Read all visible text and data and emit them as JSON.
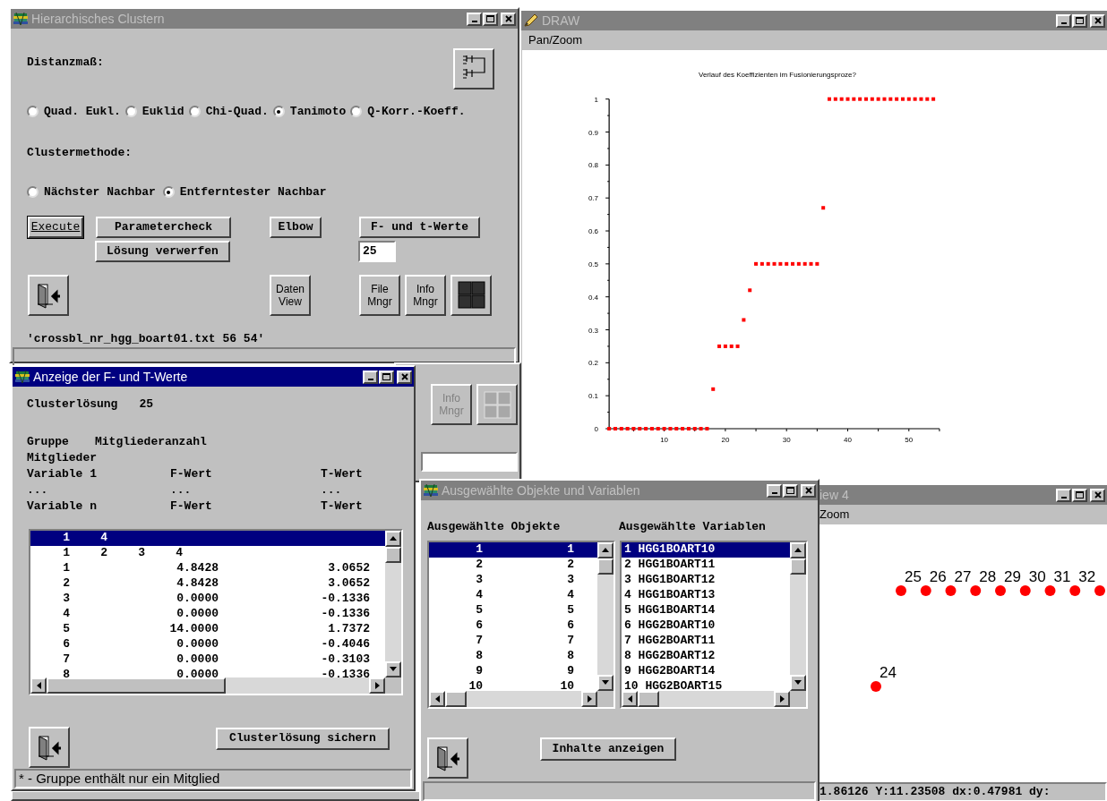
{
  "cluster_window": {
    "title": "Hierarchisches Clustern",
    "active": false,
    "distance_label": "Distanzmaß:",
    "distance_options": [
      {
        "label": "Quad. Eukl.",
        "selected": false
      },
      {
        "label": "Euklid",
        "selected": false
      },
      {
        "label": "Chi-Quad.",
        "selected": false
      },
      {
        "label": "Tanimoto",
        "selected": true
      },
      {
        "label": "Q-Korr.-Koeff.",
        "selected": false
      }
    ],
    "method_label": "Clustermethode:",
    "method_options": [
      {
        "label": "Nächster Nachbar",
        "selected": false
      },
      {
        "label": "Entferntester Nachbar",
        "selected": true
      }
    ],
    "action_buttons": [
      {
        "label": "Execute",
        "default": true
      },
      {
        "label": "Parametercheck",
        "default": false
      },
      {
        "label": "Elbow",
        "default": false
      },
      {
        "label": "F- und t-Werte",
        "default": false
      },
      {
        "label": "Lösung verwerfen",
        "default": false
      }
    ],
    "solution_field": {
      "value": "25"
    },
    "tool_buttons": [
      {
        "lines": [
          "Daten",
          "View"
        ]
      },
      {
        "lines": [
          "File",
          "Mngr"
        ]
      },
      {
        "lines": [
          "Info",
          "Mngr"
        ]
      }
    ],
    "file_info": "'crossbl_nr_hgg_boart01.txt 56 54'"
  },
  "behind_window": {
    "tool_buttons": [
      {
        "lines": [
          "Info",
          "Mngr"
        ],
        "disabled": true
      }
    ]
  },
  "draw_window": {
    "title": "DRAW",
    "active": false,
    "menu": [
      "Pan/Zoom"
    ],
    "chart_data": {
      "type": "scatter",
      "title": "Verlauf des Koeffizienten im Fusionierungsproze?",
      "x": [
        1,
        2,
        3,
        4,
        5,
        6,
        7,
        8,
        9,
        10,
        11,
        12,
        13,
        14,
        15,
        16,
        17,
        18,
        19,
        20,
        21,
        22,
        23,
        24,
        25,
        26,
        27,
        28,
        29,
        30,
        31,
        32,
        33,
        34,
        35,
        36,
        37,
        38,
        39,
        40,
        41,
        42,
        43,
        44,
        45,
        46,
        47,
        48,
        49,
        50,
        51,
        52,
        53,
        54
      ],
      "series": [
        {
          "color": "#ff0000",
          "values": [
            0,
            0,
            0,
            0,
            0,
            0,
            0,
            0,
            0,
            0,
            0,
            0,
            0,
            0,
            0,
            0,
            0,
            0.12,
            0.25,
            0.25,
            0.25,
            0.25,
            0.33,
            0.42,
            0.5,
            0.5,
            0.5,
            0.5,
            0.5,
            0.5,
            0.5,
            0.5,
            0.5,
            0.5,
            0.5,
            0.67,
            1,
            1,
            1,
            1,
            1,
            1,
            1,
            1,
            1,
            1,
            1,
            1,
            1,
            1,
            1,
            1,
            1,
            1
          ]
        }
      ],
      "xlim": [
        1,
        55
      ],
      "ylim": [
        0,
        1
      ],
      "xticks": [
        10,
        20,
        30,
        40,
        50
      ],
      "yticks": [
        0,
        0.1,
        0.2,
        0.3,
        0.4,
        0.5,
        0.6,
        0.7,
        0.8,
        0.9,
        1
      ]
    }
  },
  "view_window": {
    "title": "iew 4",
    "active": false,
    "menu": [
      "Zoom"
    ],
    "points": [
      {
        "label": "24",
        "kind": "low"
      },
      {
        "label": "25",
        "kind": "high"
      },
      {
        "label": "26",
        "kind": "high"
      },
      {
        "label": "27",
        "kind": "high"
      },
      {
        "label": "28",
        "kind": "high"
      },
      {
        "label": "29",
        "kind": "high"
      },
      {
        "label": "30",
        "kind": "high"
      },
      {
        "label": "31",
        "kind": "high"
      },
      {
        "label": "32",
        "kind": "high"
      },
      {
        "kind": "high"
      }
    ],
    "status": "1.86126 Y:11.23508 dx:0.47981 dy:"
  },
  "selection_window": {
    "title": "Ausgewählte Objekte und Variablen",
    "active": false,
    "objects_label": "Ausgewählte Objekte",
    "variables_label": "Ausgewählte Variablen",
    "objects": [
      {
        "cells": [
          "1",
          "1"
        ],
        "selected": true
      },
      {
        "cells": [
          "2",
          "2"
        ],
        "selected": false
      },
      {
        "cells": [
          "3",
          "3"
        ],
        "selected": false
      },
      {
        "cells": [
          "4",
          "4"
        ],
        "selected": false
      },
      {
        "cells": [
          "5",
          "5"
        ],
        "selected": false
      },
      {
        "cells": [
          "6",
          "6"
        ],
        "selected": false
      },
      {
        "cells": [
          "7",
          "7"
        ],
        "selected": false
      },
      {
        "cells": [
          "8",
          "8"
        ],
        "selected": false
      },
      {
        "cells": [
          "9",
          "9"
        ],
        "selected": false
      },
      {
        "cells": [
          "10",
          "10"
        ],
        "selected": false
      }
    ],
    "variables": [
      {
        "text": "1 HGG1BOART10",
        "selected": true
      },
      {
        "text": "2 HGG1BOART11",
        "selected": false
      },
      {
        "text": "3 HGG1BOART12",
        "selected": false
      },
      {
        "text": "4 HGG1BOART13",
        "selected": false
      },
      {
        "text": "5 HGG1BOART14",
        "selected": false
      },
      {
        "text": "6 HGG2BOART10",
        "selected": false
      },
      {
        "text": "7 HGG2BOART11",
        "selected": false
      },
      {
        "text": "8 HGG2BOART12",
        "selected": false
      },
      {
        "text": "9 HGG2BOART14",
        "selected": false
      },
      {
        "text": "10 HGG2BOART15",
        "selected": false
      }
    ],
    "show_button": "Inhalte anzeigen"
  },
  "values_window": {
    "title": "Anzeige der F- und T-Werte",
    "active": true,
    "solution_label": "Clusterlösung",
    "solution_value": "25",
    "legend": [
      {
        "kind": "group",
        "cells": [
          "Gruppe",
          "Mitgliederanzahl"
        ]
      },
      {
        "kind": "group",
        "cells": [
          "Mitglieder"
        ]
      },
      {
        "kind": "variable",
        "cells": [
          "Variable 1",
          "F-Wert",
          "T-Wert"
        ]
      },
      {
        "kind": "variable",
        "cells": [
          "...",
          "...",
          "..."
        ]
      },
      {
        "kind": "variable",
        "cells": [
          "Variable n",
          "F-Wert",
          "T-Wert"
        ]
      }
    ],
    "rows": [
      {
        "kind": "group",
        "cells": [
          "1",
          "4"
        ],
        "selected": true
      },
      {
        "kind": "group",
        "cells": [
          "1",
          "2",
          "3",
          "4"
        ],
        "selected": false
      },
      {
        "kind": "variable",
        "cells": [
          "1",
          "4.8428",
          "3.0652"
        ],
        "selected": false
      },
      {
        "kind": "variable",
        "cells": [
          "2",
          "4.8428",
          "3.0652"
        ],
        "selected": false
      },
      {
        "kind": "variable",
        "cells": [
          "3",
          "0.0000",
          "-0.1336"
        ],
        "selected": false
      },
      {
        "kind": "variable",
        "cells": [
          "4",
          "0.0000",
          "-0.1336"
        ],
        "selected": false
      },
      {
        "kind": "variable",
        "cells": [
          "5",
          "14.0000",
          "1.7372"
        ],
        "selected": false
      },
      {
        "kind": "variable",
        "cells": [
          "6",
          "0.0000",
          "-0.4046"
        ],
        "selected": false
      },
      {
        "kind": "variable",
        "cells": [
          "7",
          "0.0000",
          "-0.3103"
        ],
        "selected": false
      },
      {
        "kind": "variable",
        "cells": [
          "8",
          "0.0000",
          "-0.1336"
        ],
        "selected": false
      }
    ],
    "save_button": "Clusterlösung sichern",
    "status": "* - Gruppe enthält nur ein Mitglied"
  }
}
